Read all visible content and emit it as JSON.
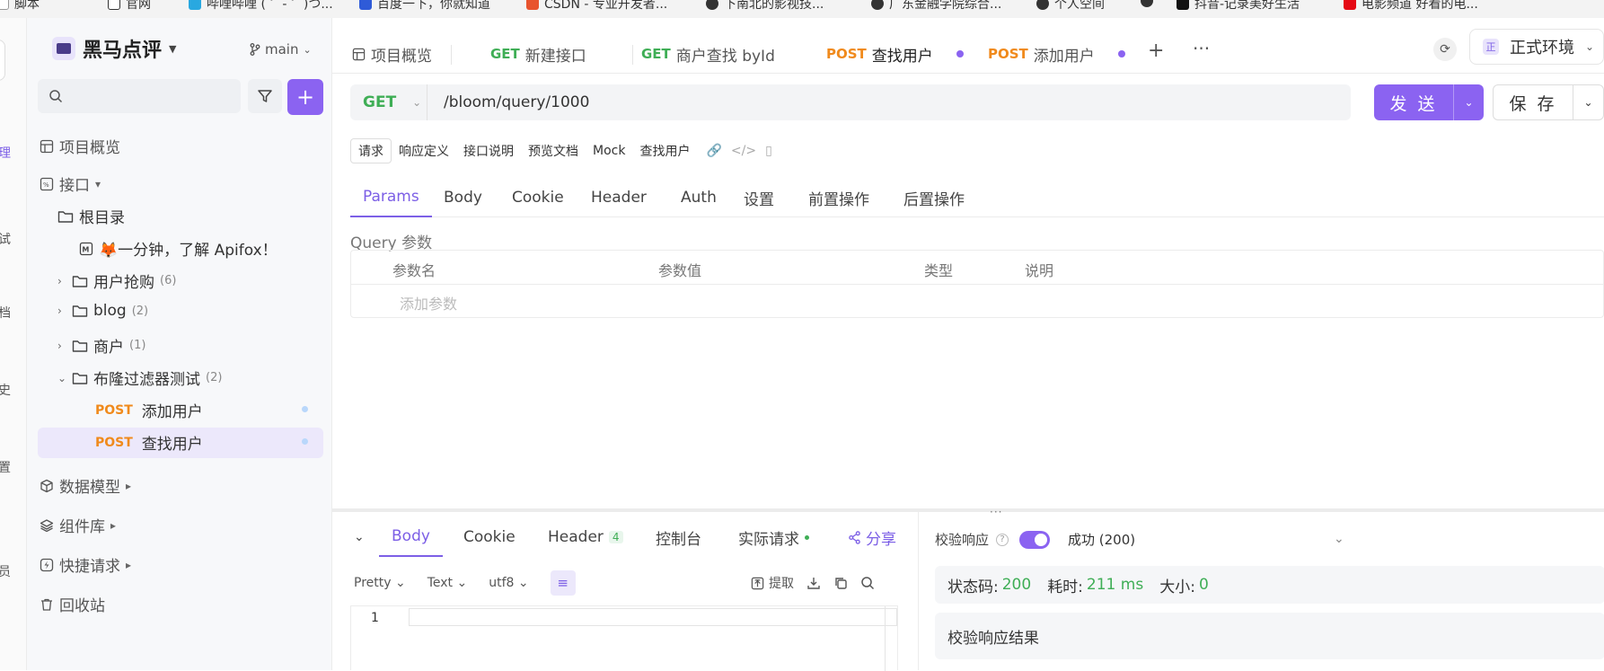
{
  "bookmarks": [
    "脚本",
    "官网",
    "哔哩哔哩 ( ゜- ゜)つ...",
    "百度一下，你就知道",
    "CSDN - 专业开发者...",
    "下南北的影视技...",
    "广东金融学院综合...",
    "个人空间",
    "抖音-记录美好生活",
    "电影频道 好看的电..."
  ],
  "rail": [
    "理",
    "试",
    "档",
    "史",
    "置",
    "员"
  ],
  "project": {
    "name": "黑马点评",
    "branch": "main"
  },
  "sidebar": {
    "overview": "项目概览",
    "interfaces": "接口",
    "root": "根目录",
    "intro": "🦊一分钟，了解 Apifox！",
    "folders": [
      {
        "label": "用户抢购",
        "count": "(6)"
      },
      {
        "label": "blog",
        "count": "(2)"
      },
      {
        "label": "商户",
        "count": "(1)"
      },
      {
        "label": "布隆过滤器测试",
        "count": "(2)"
      }
    ],
    "endpoints": [
      {
        "method": "POST",
        "label": "添加用户"
      },
      {
        "method": "POST",
        "label": "查找用户"
      }
    ],
    "data_models": "数据模型",
    "components": "组件库",
    "quick_requests": "快捷请求",
    "trash": "回收站"
  },
  "tabs": [
    {
      "method": "",
      "label": "项目概览"
    },
    {
      "method": "GET",
      "label": "新建接口"
    },
    {
      "method": "GET",
      "label": "商户查找 byId"
    },
    {
      "method": "POST",
      "label": "查找用户"
    },
    {
      "method": "POST",
      "label": "添加用户"
    }
  ],
  "env": {
    "tag": "正",
    "label": "正式环境"
  },
  "request": {
    "method": "GET",
    "url": "/bloom/query/1000",
    "send": "发 送",
    "save": "保 存"
  },
  "subtabs": [
    "请求",
    "响应定义",
    "接口说明",
    "预览文档",
    "Mock",
    "查找用户"
  ],
  "params_tabs": [
    "Params",
    "Body",
    "Cookie",
    "Header",
    "Auth",
    "设置",
    "前置操作",
    "后置操作"
  ],
  "query": {
    "label": "Query 参数",
    "columns": [
      "参数名",
      "参数值",
      "类型",
      "说明"
    ],
    "add": "添加参数"
  },
  "response": {
    "tabs": [
      "Body",
      "Cookie",
      "Header",
      "控制台",
      "实际请求"
    ],
    "header_count": "4",
    "share": "分享",
    "format": [
      "Pretty",
      "Text",
      "utf8"
    ],
    "extract": "提取",
    "line_number": "1",
    "validate_label": "校验响应",
    "validate_result": "成功 (200)",
    "status_label": "状态码:",
    "status_value": "200",
    "time_label": "耗时:",
    "time_value": "211 ms",
    "size_label": "大小:",
    "size_value": "0",
    "result_title": "校验响应结果"
  },
  "colors": {
    "accent": "#8b63f1",
    "get": "#3fae56",
    "post": "#f08a1c"
  }
}
